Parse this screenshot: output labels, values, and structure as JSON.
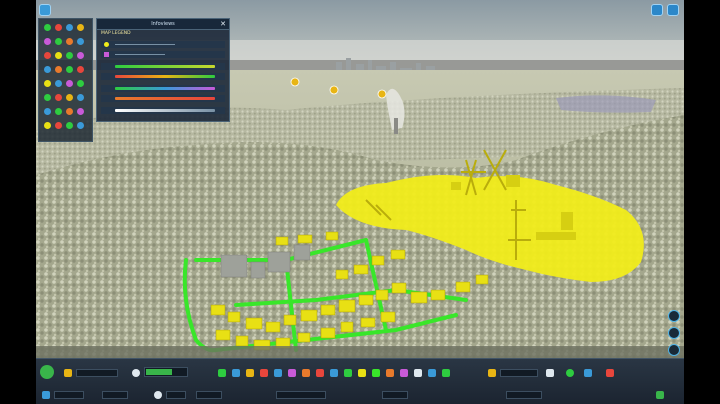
{
  "info_panel": {
    "title": "Infoviews",
    "close": "✕",
    "legend_label": "MAP LEGEND"
  },
  "icons": {
    "top_right": [
      "help-icon",
      "settings-icon"
    ],
    "close": "close-icon"
  },
  "colors": {
    "highlight": "#f1ec1a",
    "road_overlay": "#39e62a",
    "accent": "#2b87c9",
    "ui_panel": "#1c2838"
  }
}
